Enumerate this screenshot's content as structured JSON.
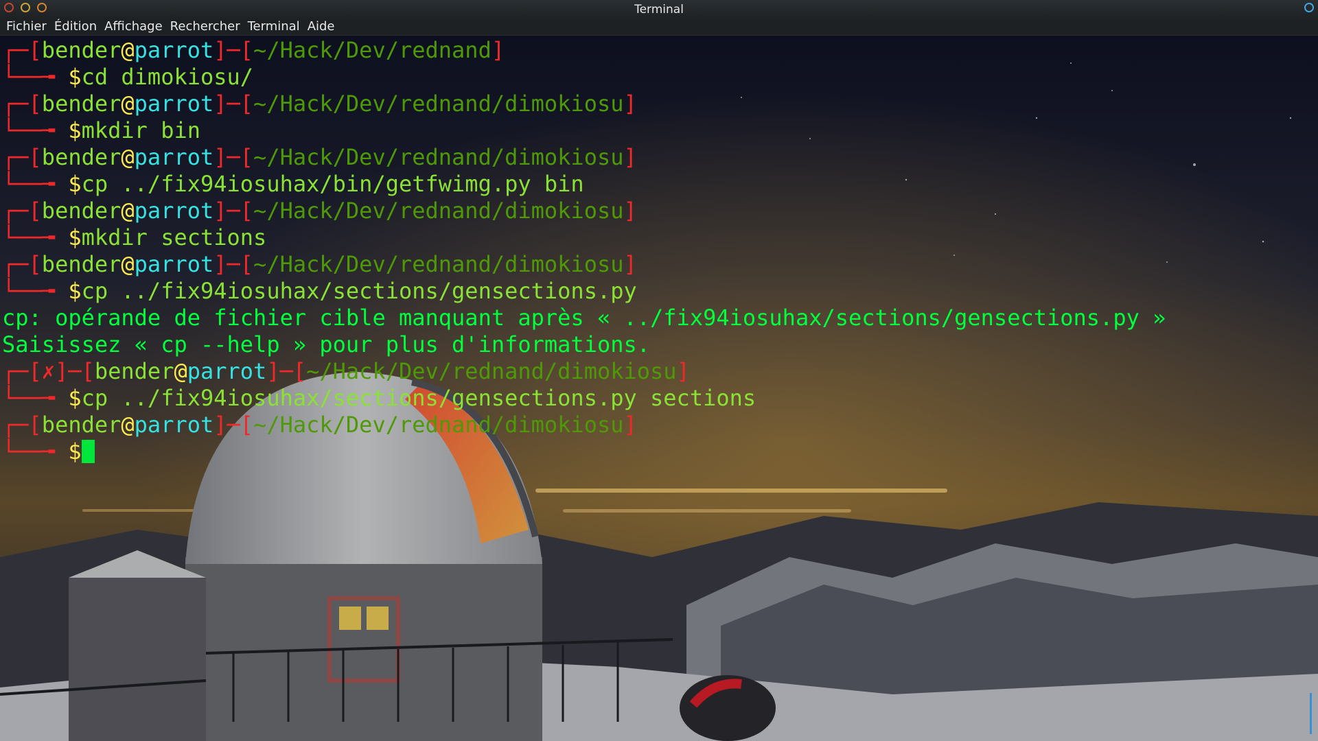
{
  "window": {
    "title": "Terminal",
    "colors": {
      "close": "#c6452e",
      "minimize": "#cda434",
      "maximize": "#d8822f",
      "accent": "#3fa7e0"
    }
  },
  "menubar": {
    "items": [
      {
        "label": "Fichier"
      },
      {
        "label": "Édition"
      },
      {
        "label": "Affichage"
      },
      {
        "label": "Rechercher"
      },
      {
        "label": "Terminal"
      },
      {
        "label": "Aide"
      }
    ]
  },
  "prompt": {
    "user": "bender",
    "at": "@",
    "host": "parrot",
    "dollar": "$",
    "error_mark": "✗",
    "corner_top": "┌─",
    "corner_bottom": "└──╼ "
  },
  "session": [
    {
      "path": "~/Hack/Dev/rednand",
      "command": "cd dimokiosu/"
    },
    {
      "path": "~/Hack/Dev/rednand/dimokiosu",
      "command": "mkdir bin"
    },
    {
      "path": "~/Hack/Dev/rednand/dimokiosu",
      "command": "cp ../fix94iosuhax/bin/getfwimg.py bin"
    },
    {
      "path": "~/Hack/Dev/rednand/dimokiosu",
      "command": "mkdir sections"
    },
    {
      "path": "~/Hack/Dev/rednand/dimokiosu",
      "command": "cp ../fix94iosuhax/sections/gensections.py",
      "output": [
        "cp: opérande de fichier cible manquant après « ../fix94iosuhax/sections/gensections.py »",
        "Saisissez « cp --help » pour plus d'informations."
      ]
    },
    {
      "path": "~/Hack/Dev/rednand/dimokiosu",
      "error": true,
      "command": "cp ../fix94iosuhax/sections/gensections.py sections"
    },
    {
      "path": "~/Hack/Dev/rednand/dimokiosu",
      "command": "",
      "active": true
    }
  ],
  "theme": {
    "bracket": "#ef2929",
    "user": "#8ae234",
    "at": "#fce94f",
    "host": "#34e2e2",
    "path": "#4e9a06",
    "output": "#00ff3c",
    "cursor": "#00e63a"
  }
}
